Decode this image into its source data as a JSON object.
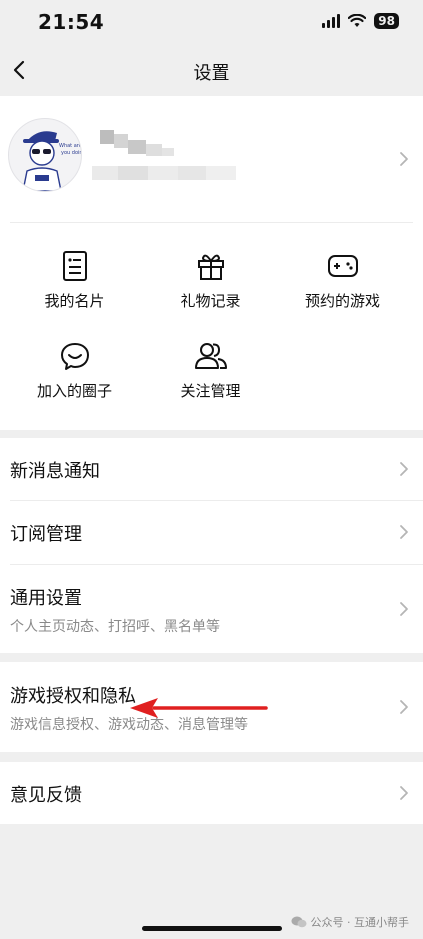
{
  "status_bar": {
    "time": "21:54",
    "battery": "98"
  },
  "nav": {
    "title": "设置"
  },
  "quick_actions": [
    {
      "label": "我的名片",
      "icon": "name-card-icon"
    },
    {
      "label": "礼物记录",
      "icon": "gift-icon"
    },
    {
      "label": "预约的游戏",
      "icon": "gamepad-icon"
    },
    {
      "label": "加入的圈子",
      "icon": "chat-bubble-icon"
    },
    {
      "label": "关注管理",
      "icon": "people-icon"
    }
  ],
  "settings": {
    "notifications": {
      "title": "新消息通知"
    },
    "subscriptions": {
      "title": "订阅管理"
    },
    "general": {
      "title": "通用设置",
      "subtitle": "个人主页动态、打招呼、黑名单等"
    },
    "game_privacy": {
      "title": "游戏授权和隐私",
      "subtitle": "游戏信息授权、游戏动态、消息管理等"
    },
    "feedback": {
      "title": "意见反馈"
    }
  },
  "watermark": {
    "text": "公众号 · 互通小帮手"
  },
  "colors": {
    "background": "#efefef",
    "card": "#ffffff",
    "annotation_arrow": "#e02020"
  }
}
